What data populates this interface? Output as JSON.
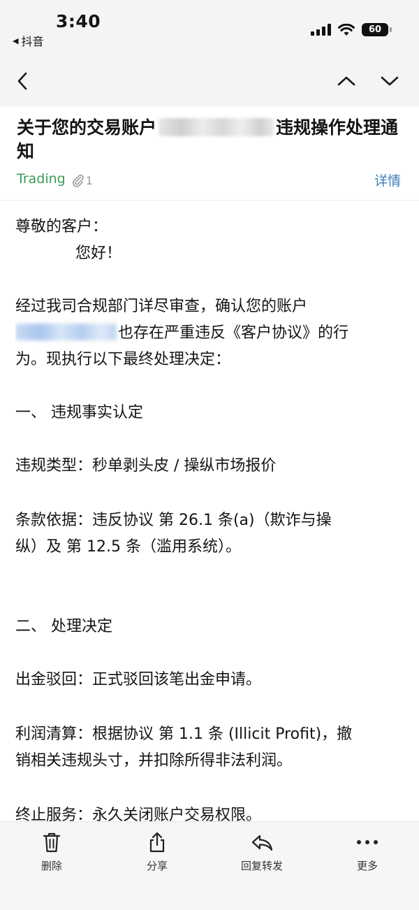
{
  "status_bar": {
    "time": "3:40",
    "back_app": "抖音",
    "battery": "60"
  },
  "icons": {
    "back": "chevron-left-icon",
    "prev": "chevron-up-icon",
    "next": "chevron-down-icon",
    "attachment": "paperclip-icon",
    "delete": "trash-icon",
    "share": "share-icon",
    "reply": "reply-icon",
    "more": "more-icon"
  },
  "header": {
    "subject_prefix": "关于您的交易账户",
    "subject_suffix": "违规操作处理通知",
    "sender": "Trading",
    "attachment_count": "1",
    "details_label": "详情"
  },
  "body": {
    "greeting": "尊敬的客户：",
    "hello": "您好！",
    "intro_line1": "经过我司合规部门详尽审查，确认您的账户",
    "intro_line2_suffix": "也存在严重违反《客户协议》的行",
    "intro_line3": "为。现执行以下最终处理决定：",
    "section1_title": "一、 违规事实认定",
    "violation_type": "违规类型：秒单剥头皮 / 操纵市场报价",
    "clause_line1": "条款依据：违反协议 第 26.1 条(a)（欺诈与操",
    "clause_line2": "纵）及 第 12.5 条（滥用系统）。",
    "section2_title": "二、 处理决定",
    "withdrawal": "出金驳回：正式驳回该笔出金申请。",
    "profit_line1": "利润清算：根据协议 第 1.1 条 (Illicit Profit)，撤",
    "profit_line2": "销相关违规头寸，并扣除所得非法利润。",
    "terminate": "终止服务：永久关闭账户交易权限。"
  },
  "toolbar": {
    "delete": "删除",
    "share": "分享",
    "reply_forward": "回复转发",
    "more": "更多"
  },
  "colors": {
    "sender": "#3a9a56",
    "link": "#3d7fb7",
    "chrome_bg": "#f4f4f6"
  }
}
